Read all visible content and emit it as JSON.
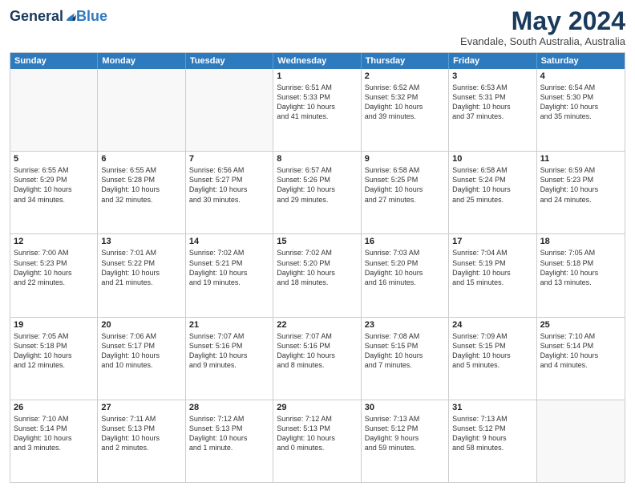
{
  "logo": {
    "general": "General",
    "blue": "Blue"
  },
  "title": "May 2024",
  "location": "Evandale, South Australia, Australia",
  "days": [
    "Sunday",
    "Monday",
    "Tuesday",
    "Wednesday",
    "Thursday",
    "Friday",
    "Saturday"
  ],
  "rows": [
    [
      {
        "day": "",
        "text": ""
      },
      {
        "day": "",
        "text": ""
      },
      {
        "day": "",
        "text": ""
      },
      {
        "day": "1",
        "text": "Sunrise: 6:51 AM\nSunset: 5:33 PM\nDaylight: 10 hours\nand 41 minutes."
      },
      {
        "day": "2",
        "text": "Sunrise: 6:52 AM\nSunset: 5:32 PM\nDaylight: 10 hours\nand 39 minutes."
      },
      {
        "day": "3",
        "text": "Sunrise: 6:53 AM\nSunset: 5:31 PM\nDaylight: 10 hours\nand 37 minutes."
      },
      {
        "day": "4",
        "text": "Sunrise: 6:54 AM\nSunset: 5:30 PM\nDaylight: 10 hours\nand 35 minutes."
      }
    ],
    [
      {
        "day": "5",
        "text": "Sunrise: 6:55 AM\nSunset: 5:29 PM\nDaylight: 10 hours\nand 34 minutes."
      },
      {
        "day": "6",
        "text": "Sunrise: 6:55 AM\nSunset: 5:28 PM\nDaylight: 10 hours\nand 32 minutes."
      },
      {
        "day": "7",
        "text": "Sunrise: 6:56 AM\nSunset: 5:27 PM\nDaylight: 10 hours\nand 30 minutes."
      },
      {
        "day": "8",
        "text": "Sunrise: 6:57 AM\nSunset: 5:26 PM\nDaylight: 10 hours\nand 29 minutes."
      },
      {
        "day": "9",
        "text": "Sunrise: 6:58 AM\nSunset: 5:25 PM\nDaylight: 10 hours\nand 27 minutes."
      },
      {
        "day": "10",
        "text": "Sunrise: 6:58 AM\nSunset: 5:24 PM\nDaylight: 10 hours\nand 25 minutes."
      },
      {
        "day": "11",
        "text": "Sunrise: 6:59 AM\nSunset: 5:23 PM\nDaylight: 10 hours\nand 24 minutes."
      }
    ],
    [
      {
        "day": "12",
        "text": "Sunrise: 7:00 AM\nSunset: 5:23 PM\nDaylight: 10 hours\nand 22 minutes."
      },
      {
        "day": "13",
        "text": "Sunrise: 7:01 AM\nSunset: 5:22 PM\nDaylight: 10 hours\nand 21 minutes."
      },
      {
        "day": "14",
        "text": "Sunrise: 7:02 AM\nSunset: 5:21 PM\nDaylight: 10 hours\nand 19 minutes."
      },
      {
        "day": "15",
        "text": "Sunrise: 7:02 AM\nSunset: 5:20 PM\nDaylight: 10 hours\nand 18 minutes."
      },
      {
        "day": "16",
        "text": "Sunrise: 7:03 AM\nSunset: 5:20 PM\nDaylight: 10 hours\nand 16 minutes."
      },
      {
        "day": "17",
        "text": "Sunrise: 7:04 AM\nSunset: 5:19 PM\nDaylight: 10 hours\nand 15 minutes."
      },
      {
        "day": "18",
        "text": "Sunrise: 7:05 AM\nSunset: 5:18 PM\nDaylight: 10 hours\nand 13 minutes."
      }
    ],
    [
      {
        "day": "19",
        "text": "Sunrise: 7:05 AM\nSunset: 5:18 PM\nDaylight: 10 hours\nand 12 minutes."
      },
      {
        "day": "20",
        "text": "Sunrise: 7:06 AM\nSunset: 5:17 PM\nDaylight: 10 hours\nand 10 minutes."
      },
      {
        "day": "21",
        "text": "Sunrise: 7:07 AM\nSunset: 5:16 PM\nDaylight: 10 hours\nand 9 minutes."
      },
      {
        "day": "22",
        "text": "Sunrise: 7:07 AM\nSunset: 5:16 PM\nDaylight: 10 hours\nand 8 minutes."
      },
      {
        "day": "23",
        "text": "Sunrise: 7:08 AM\nSunset: 5:15 PM\nDaylight: 10 hours\nand 7 minutes."
      },
      {
        "day": "24",
        "text": "Sunrise: 7:09 AM\nSunset: 5:15 PM\nDaylight: 10 hours\nand 5 minutes."
      },
      {
        "day": "25",
        "text": "Sunrise: 7:10 AM\nSunset: 5:14 PM\nDaylight: 10 hours\nand 4 minutes."
      }
    ],
    [
      {
        "day": "26",
        "text": "Sunrise: 7:10 AM\nSunset: 5:14 PM\nDaylight: 10 hours\nand 3 minutes."
      },
      {
        "day": "27",
        "text": "Sunrise: 7:11 AM\nSunset: 5:13 PM\nDaylight: 10 hours\nand 2 minutes."
      },
      {
        "day": "28",
        "text": "Sunrise: 7:12 AM\nSunset: 5:13 PM\nDaylight: 10 hours\nand 1 minute."
      },
      {
        "day": "29",
        "text": "Sunrise: 7:12 AM\nSunset: 5:13 PM\nDaylight: 10 hours\nand 0 minutes."
      },
      {
        "day": "30",
        "text": "Sunrise: 7:13 AM\nSunset: 5:12 PM\nDaylight: 9 hours\nand 59 minutes."
      },
      {
        "day": "31",
        "text": "Sunrise: 7:13 AM\nSunset: 5:12 PM\nDaylight: 9 hours\nand 58 minutes."
      },
      {
        "day": "",
        "text": ""
      }
    ]
  ]
}
